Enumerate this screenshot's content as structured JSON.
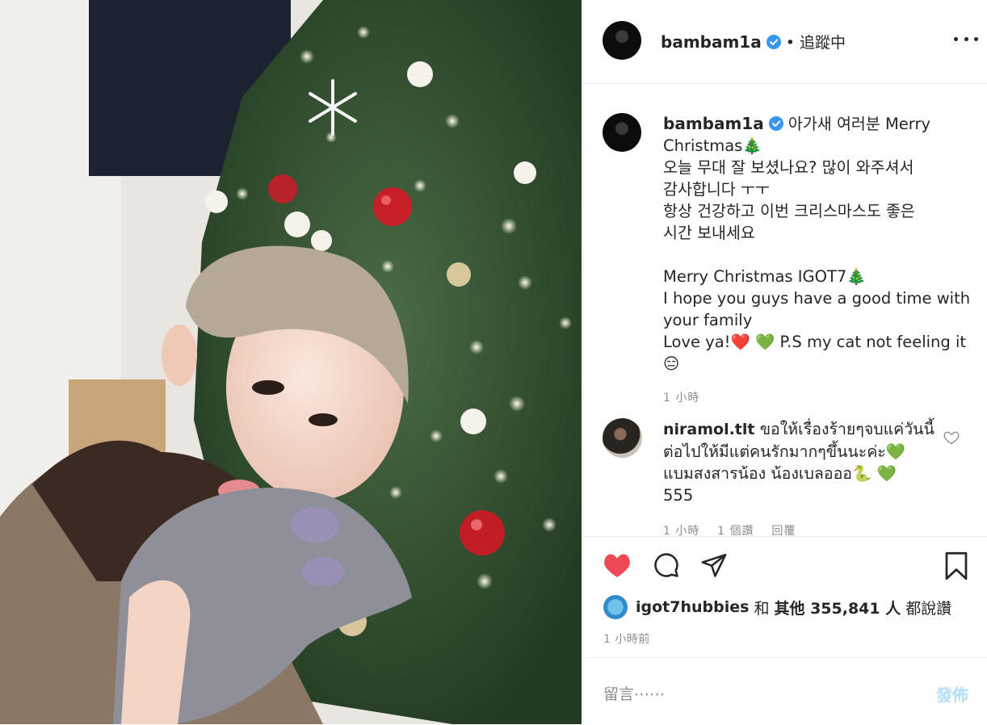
{
  "post": {
    "author": "bambam1a",
    "follow_status": "• 追蹤中",
    "caption_lines": [
      "아가새 여러분 Merry",
      "Christmas🎄",
      "오늘 무대 잘 보셨나요? 많이 와주셔서",
      "감사합니다 ㅜㅜ",
      "항상 건강하고 이번 크리스마스도 좋은",
      "시간 보내세요",
      "",
      "Merry Christmas IGOT7🎄",
      "I hope you guys have a good time with",
      "your family",
      "Love ya!❤️ 💚 P.S my cat not feeling it",
      "😑"
    ],
    "caption_time": "1 小時"
  },
  "comments": [
    {
      "user": "niramol.tlt",
      "lines": [
        "ขอให้เรื่องร้ายๆจบแค่วันนี้",
        "ต่อไปให้มีแต่คนรักมากๆขึ้นนะค่ะ💚",
        "แบมสงสารน้อง น้องเบลอออ🐍 💚",
        "555"
      ],
      "meta": "1 小時    1 個讚    回覆"
    }
  ],
  "likes": {
    "user": "igot7hubbies",
    "and": "和",
    "others": "其他 355,841 人",
    "suffix": "都說讚"
  },
  "timestamp": "1 小時前",
  "comment_input": {
    "placeholder": "留言⋯⋯",
    "post_label": "發佈"
  },
  "colors": {
    "heart": "#ed4956",
    "verified": "#3897f0",
    "post_disabled": "#b2dffc"
  }
}
